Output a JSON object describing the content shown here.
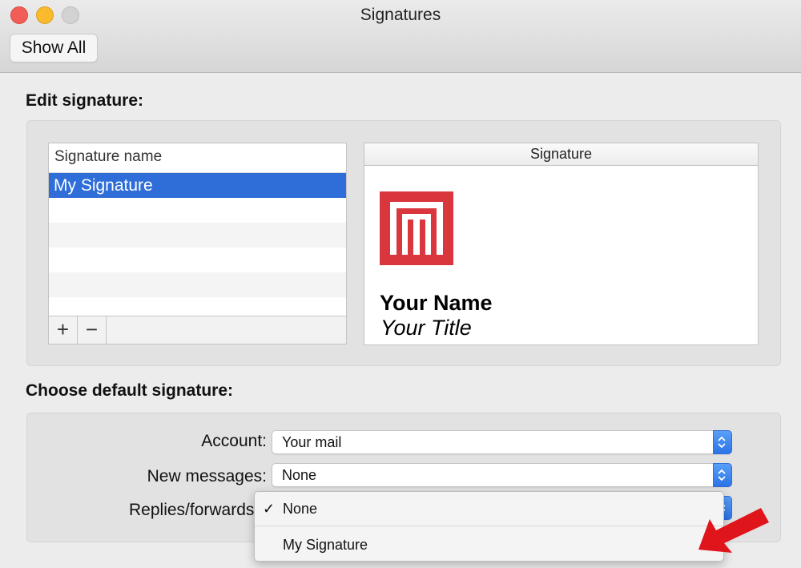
{
  "window": {
    "title": "Signatures",
    "show_all_label": "Show All"
  },
  "edit_signature": {
    "heading": "Edit signature:",
    "list_header": "Signature name",
    "items": [
      "My Signature"
    ],
    "add_label": "+",
    "remove_label": "−",
    "preview_header": "Signature",
    "preview": {
      "name": "Your Name",
      "title": "Your Title",
      "logo_icon": "red-m-logo-icon",
      "logo_color": "#d9363e"
    }
  },
  "default_signature": {
    "heading": "Choose default signature:",
    "account_label": "Account:",
    "account_value": "Your mail",
    "new_messages_label": "New messages:",
    "new_messages_value": "None",
    "replies_label": "Replies/forwards:",
    "replies_menu": {
      "options": [
        "None",
        "My Signature"
      ],
      "selected": "None",
      "check_mark": "✓"
    }
  },
  "colors": {
    "selection": "#2f6ed8",
    "arrow": "#e0141b",
    "accent": "#3b82f6"
  },
  "icons": {
    "stepper": "up-down-chevron-icon",
    "annotation": "red-arrow-icon"
  }
}
